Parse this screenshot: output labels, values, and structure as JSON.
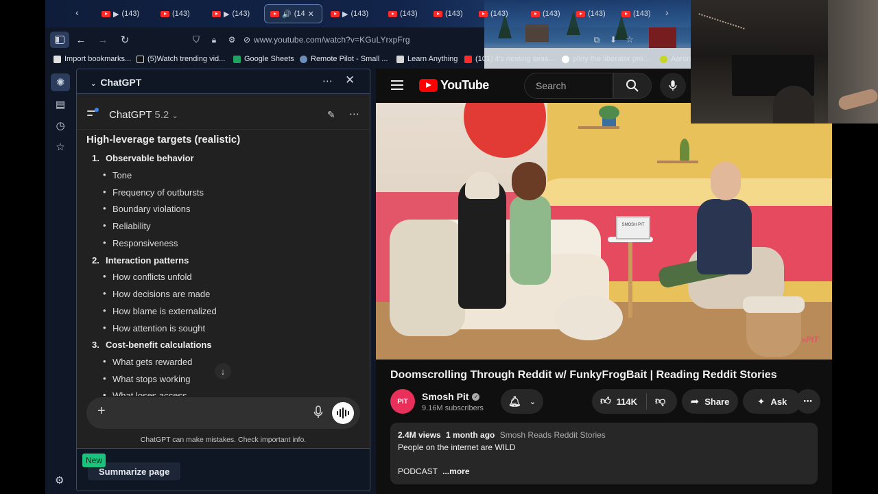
{
  "browser": {
    "tabs": [
      {
        "label": "(143)",
        "active": false
      },
      {
        "label": "(143)",
        "active": false
      },
      {
        "label": "(143)",
        "active": false
      },
      {
        "label": "(14",
        "active": true
      },
      {
        "label": "(143)",
        "active": false
      },
      {
        "label": "(143)",
        "active": false
      },
      {
        "label": "(143)",
        "active": false
      },
      {
        "label": "(143)",
        "active": false
      },
      {
        "label": "(143)",
        "active": false
      },
      {
        "label": "(143)",
        "active": false
      },
      {
        "label": "(143)",
        "active": false
      }
    ],
    "url": "www.youtube.com/watch?v=KGuLYrxpFrg",
    "bookmarks": [
      {
        "label": "Import bookmarks...",
        "icon": "import-icon",
        "color": "#e0e0e0"
      },
      {
        "label": "(5)Watch trending vid...",
        "icon": "tiktok-icon",
        "color": "#111111"
      },
      {
        "label": "Google Sheets",
        "icon": "sheets-icon",
        "color": "#1ea362"
      },
      {
        "label": "Remote Pilot - Small ...",
        "icon": "globe-icon",
        "color": "#6b8fb8"
      },
      {
        "label": "Learn Anything",
        "icon": "book-icon",
        "color": "#d6d6d6"
      },
      {
        "label": "(101) it's nesting seas...",
        "icon": "youtube-icon",
        "color": "#ff2a2a"
      },
      {
        "label": "pliny the liberator pro...",
        "icon": "google-icon",
        "color": "#ffffff"
      },
      {
        "label": "Aeron",
        "icon": "aeron-icon",
        "color": "#c6d629"
      }
    ]
  },
  "chatgpt": {
    "panel_title": "ChatGPT",
    "model_name": "ChatGPT",
    "model_version": "5.2",
    "heading": "High-leverage targets (realistic)",
    "sections": [
      {
        "num": "1.",
        "title": "Observable behavior",
        "items": [
          "Tone",
          "Frequency of outbursts",
          "Boundary violations",
          "Reliability",
          "Responsiveness"
        ]
      },
      {
        "num": "2.",
        "title": "Interaction patterns",
        "items": [
          "How conflicts unfold",
          "How decisions are made",
          "How blame is externalized",
          "How attention is sought"
        ]
      },
      {
        "num": "3.",
        "title": "Cost-benefit calculations",
        "items": [
          "What gets rewarded",
          "What stops working",
          "What loses access"
        ]
      }
    ],
    "disclaimer": "ChatGPT can make mistakes. Check important info.",
    "new_badge": "New",
    "summarize_label": "Summarize page"
  },
  "youtube": {
    "logo_text": "YouTube",
    "search_placeholder": "Search",
    "video_title": "Doomscrolling Through Reddit w/ FunkyFrogBait | Reading Reddit Stories",
    "channel_name": "Smosh Pit",
    "channel_avatar_text": "PIT",
    "subscribers": "9.16M subscribers",
    "likes": "114K",
    "share_label": "Share",
    "ask_label": "Ask",
    "views": "2.4M views",
    "age": "1 month ago",
    "playlist": "Smosh Reads Reddit Stories",
    "description_line1": "People on the internet are WILD",
    "description_line2": "PODCAST",
    "more_label": "...more",
    "sign_text": "SMOSH PIT",
    "watermark_text": "PIT",
    "brand_color": "#ff0000"
  }
}
